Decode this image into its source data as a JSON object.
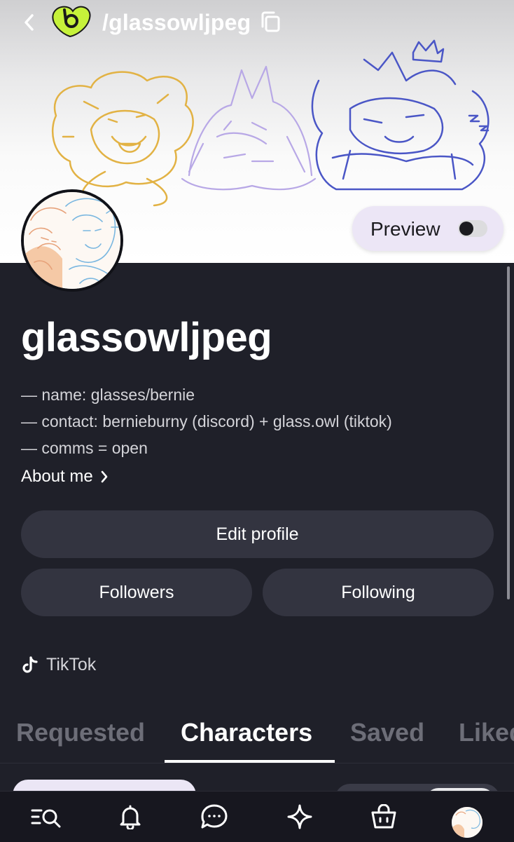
{
  "header": {
    "handle": "/glassowljpeg",
    "back_icon": "chevron-left-icon",
    "logo": "app-logo",
    "copy_icon": "copy-icon"
  },
  "preview": {
    "label": "Preview",
    "enabled": false
  },
  "profile": {
    "username": "glassowljpeg",
    "bio": [
      "— name: glasses/bernie",
      "— contact: bernieburny (discord) + glass.owl (tiktok)",
      "— comms = open"
    ],
    "about_label": "About me"
  },
  "buttons": {
    "edit_profile": "Edit profile",
    "followers": "Followers",
    "following": "Following"
  },
  "links": {
    "tiktok": "TikTok"
  },
  "tabs": [
    {
      "label": "Requested",
      "active": false
    },
    {
      "label": "Characters",
      "active": true
    },
    {
      "label": "Saved",
      "active": false
    },
    {
      "label": "Liked",
      "active": false
    }
  ],
  "navbar": [
    "browse-icon",
    "bell-icon",
    "chat-icon",
    "sparkle-icon",
    "shop-bag-icon",
    "profile-avatar"
  ],
  "colors": {
    "background": "#1f2029",
    "button": "#333440",
    "accent_green": "#c6f23a"
  }
}
